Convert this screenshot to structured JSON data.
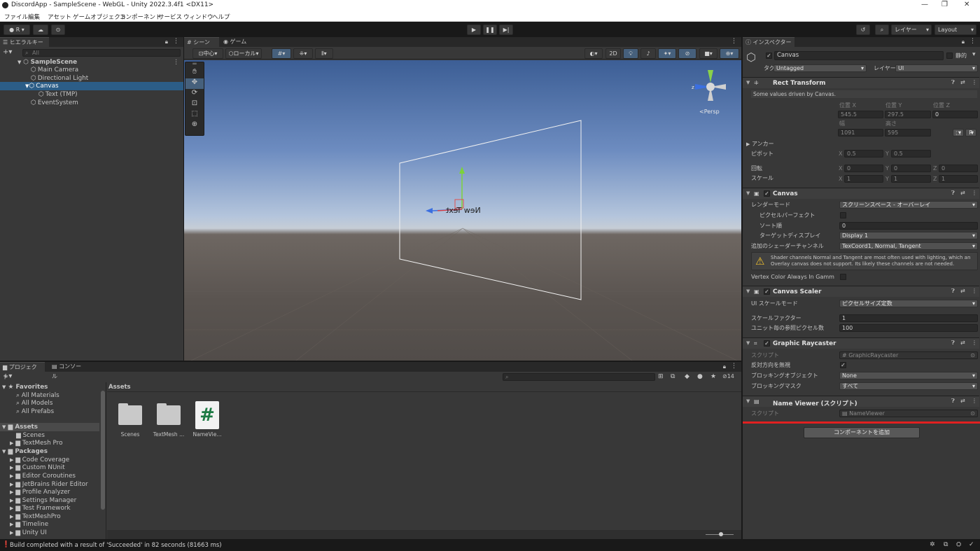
{
  "window": {
    "title": "DiscordApp - SampleScene - WebGL - Unity 2022.3.4f1 <DX11>",
    "controls": [
      "—",
      "❐",
      "✕"
    ]
  },
  "menu": [
    "ファイル",
    "編集",
    "アセット",
    "ゲームオブジェクト",
    "コンポーネント",
    "サービス",
    "ウィンドウ",
    "ヘルプ"
  ],
  "toolbar": {
    "account": "R",
    "layers_label": "レイヤー",
    "layout_label": "Layout"
  },
  "hierarchy": {
    "tab": "ヒエラルキー",
    "search_placeholder": "All",
    "scene": "SampleScene",
    "items": [
      {
        "label": "Main Camera"
      },
      {
        "label": "Directional Light"
      },
      {
        "label": "Canvas"
      },
      {
        "label": "Text (TMP)"
      },
      {
        "label": "EventSystem"
      }
    ]
  },
  "scene_view": {
    "tabs": [
      "シーン",
      "ゲーム"
    ],
    "pivot_label": "中心",
    "space_label": "ローカル",
    "mode_2d": "2D",
    "persp_label": "<Persp",
    "gizmo_text": "New Text"
  },
  "project": {
    "tabs": [
      "プロジェクト",
      "コンソール"
    ],
    "hidden_count": "14",
    "favorites_label": "Favorites",
    "favorites": [
      "All Materials",
      "All Models",
      "All Prefabs"
    ],
    "assets_label": "Assets",
    "assets_children": [
      "Scenes",
      "TextMesh Pro"
    ],
    "packages_label": "Packages",
    "packages": [
      "Code Coverage",
      "Custom NUnit",
      "Editor Coroutines",
      "JetBrains Rider Editor",
      "Profile Analyzer",
      "Settings Manager",
      "Test Framework",
      "TextMeshPro",
      "Timeline",
      "Unity UI"
    ],
    "breadcrumb": "Assets",
    "files": [
      {
        "name": "Scenes",
        "kind": "folder"
      },
      {
        "name": "TextMesh ...",
        "kind": "folder"
      },
      {
        "name": "NameVie...",
        "kind": "script"
      }
    ]
  },
  "status": {
    "message": "Build completed with a result of 'Succeeded' in 82 seconds (81663 ms)"
  },
  "inspector": {
    "tab": "インスペクター",
    "object_name": "Canvas",
    "static_label": "静的",
    "tag_label": "タグ",
    "tag_value": "Untagged",
    "layer_label": "レイヤー",
    "layer_value": "UI",
    "rect_transform": {
      "title": "Rect Transform",
      "note": "Some values driven by Canvas.",
      "pos_x_label": "位置 X",
      "pos_y_label": "位置 Y",
      "pos_z_label": "位置 Z",
      "pos_x": "545.5",
      "pos_y": "297.5",
      "pos_z": "0",
      "width_label": "幅",
      "height_label": "高さ",
      "width": "1091",
      "height": "595",
      "anchors_label": "アンカー",
      "pivot_label": "ピボット",
      "pivot_x": "0.5",
      "pivot_y": "0.5",
      "rotation_label": "回転",
      "rot_x": "0",
      "rot_y": "0",
      "rot_z": "0",
      "scale_label": "スケール",
      "scale_x": "1",
      "scale_y": "1",
      "scale_z": "1",
      "x": "X",
      "y": "Y",
      "z": "Z",
      "r": "R"
    },
    "canvas": {
      "title": "Canvas",
      "render_mode_label": "レンダーモード",
      "render_mode": "スクリーンスペース - オーバーレイ",
      "pixel_perfect_label": "ピクセルパーフェクト",
      "sort_order_label": "ソート順",
      "sort_order": "0",
      "target_display_label": "ターゲットディスプレイ",
      "target_display": "Display 1",
      "shader_channels_label": "追加のシェーダーチャンネル",
      "shader_channels": "TexCoord1, Normal, Tangent",
      "warning": "Shader channels Normal and Tangent are most often used with lighting, which an Overlay canvas does not support. Its likely these channels are not needed.",
      "vertex_color_label": "Vertex Color Always In Gamm"
    },
    "canvas_scaler": {
      "title": "Canvas Scaler",
      "ui_scale_mode_label": "UI スケールモード",
      "ui_scale_mode": "ピクセルサイズ定数",
      "scale_factor_label": "スケールファクター",
      "scale_factor": "1",
      "ref_ppu_label": "ユニット毎の参照ピクセル数",
      "ref_ppu": "100"
    },
    "graphic_raycaster": {
      "title": "Graphic Raycaster",
      "script_label": "スクリプト",
      "script": "GraphicRaycaster",
      "ignore_reversed_label": "反対方向を無視",
      "blocking_objects_label": "ブロッキングオブジェクト",
      "blocking_objects": "None",
      "blocking_mask_label": "ブロッキングマスク",
      "blocking_mask": "すべて"
    },
    "name_viewer": {
      "title": "Name Viewer (スクリプト)",
      "script_label": "スクリプト",
      "script": "NameViewer"
    },
    "add_component": "コンポーネントを追加"
  },
  "colors": {
    "selection": "#2c5d87",
    "accent_red": "#e02020",
    "folder": "#c9c9c9",
    "script_green": "#1d7a43"
  }
}
